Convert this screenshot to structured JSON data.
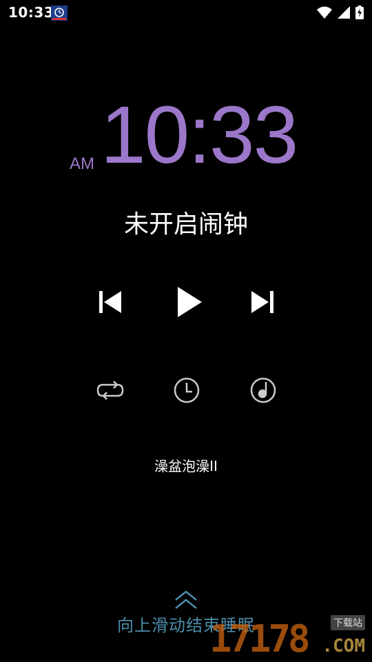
{
  "status_bar": {
    "time": "10:33",
    "icons": [
      "alarm-app-icon",
      "wifi-icon",
      "signal-icon",
      "battery-charging-icon"
    ]
  },
  "clock": {
    "ampm": "AM",
    "time": "10:33",
    "color": "#9b77c9"
  },
  "alarm_status": "未开启闹钟",
  "controls": {
    "icons": [
      "skip-previous-icon",
      "play-icon",
      "skip-next-icon"
    ]
  },
  "modes": {
    "icons": [
      "repeat-icon",
      "timer-icon",
      "music-clock-icon"
    ]
  },
  "track_name": "澡盆泡澡II",
  "swipe": {
    "icon": "chevron-up-icon",
    "text": "向上滑动结束睡眠",
    "color": "#4b8fae"
  },
  "watermark": {
    "number": "17178",
    "domain": ".COM",
    "tag": "下载站"
  }
}
